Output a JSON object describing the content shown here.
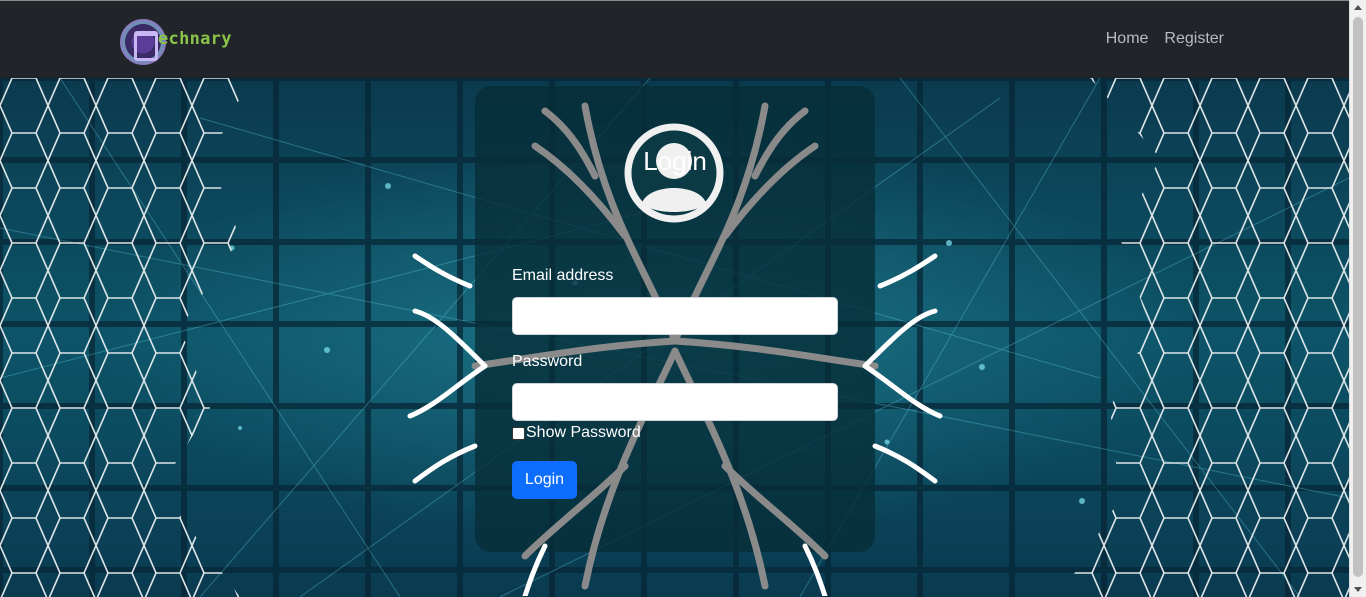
{
  "brand": {
    "text": "echnary"
  },
  "nav": {
    "items": [
      {
        "label": "Home"
      },
      {
        "label": "Register"
      }
    ]
  },
  "login": {
    "title": "Login",
    "email_label": "Email address",
    "email_value": "",
    "password_label": "Password",
    "password_value": "",
    "show_password_label": "Show Password",
    "show_password_checked": false,
    "submit_label": "Login"
  },
  "colors": {
    "navbar": "#212529",
    "primary_button": "#0d6efd",
    "hero_teal": "#0d5468",
    "brand_text": "#8bc34a"
  },
  "icons": [
    "user-avatar-icon",
    "hexagon-pattern",
    "tree-roots-graphic"
  ]
}
